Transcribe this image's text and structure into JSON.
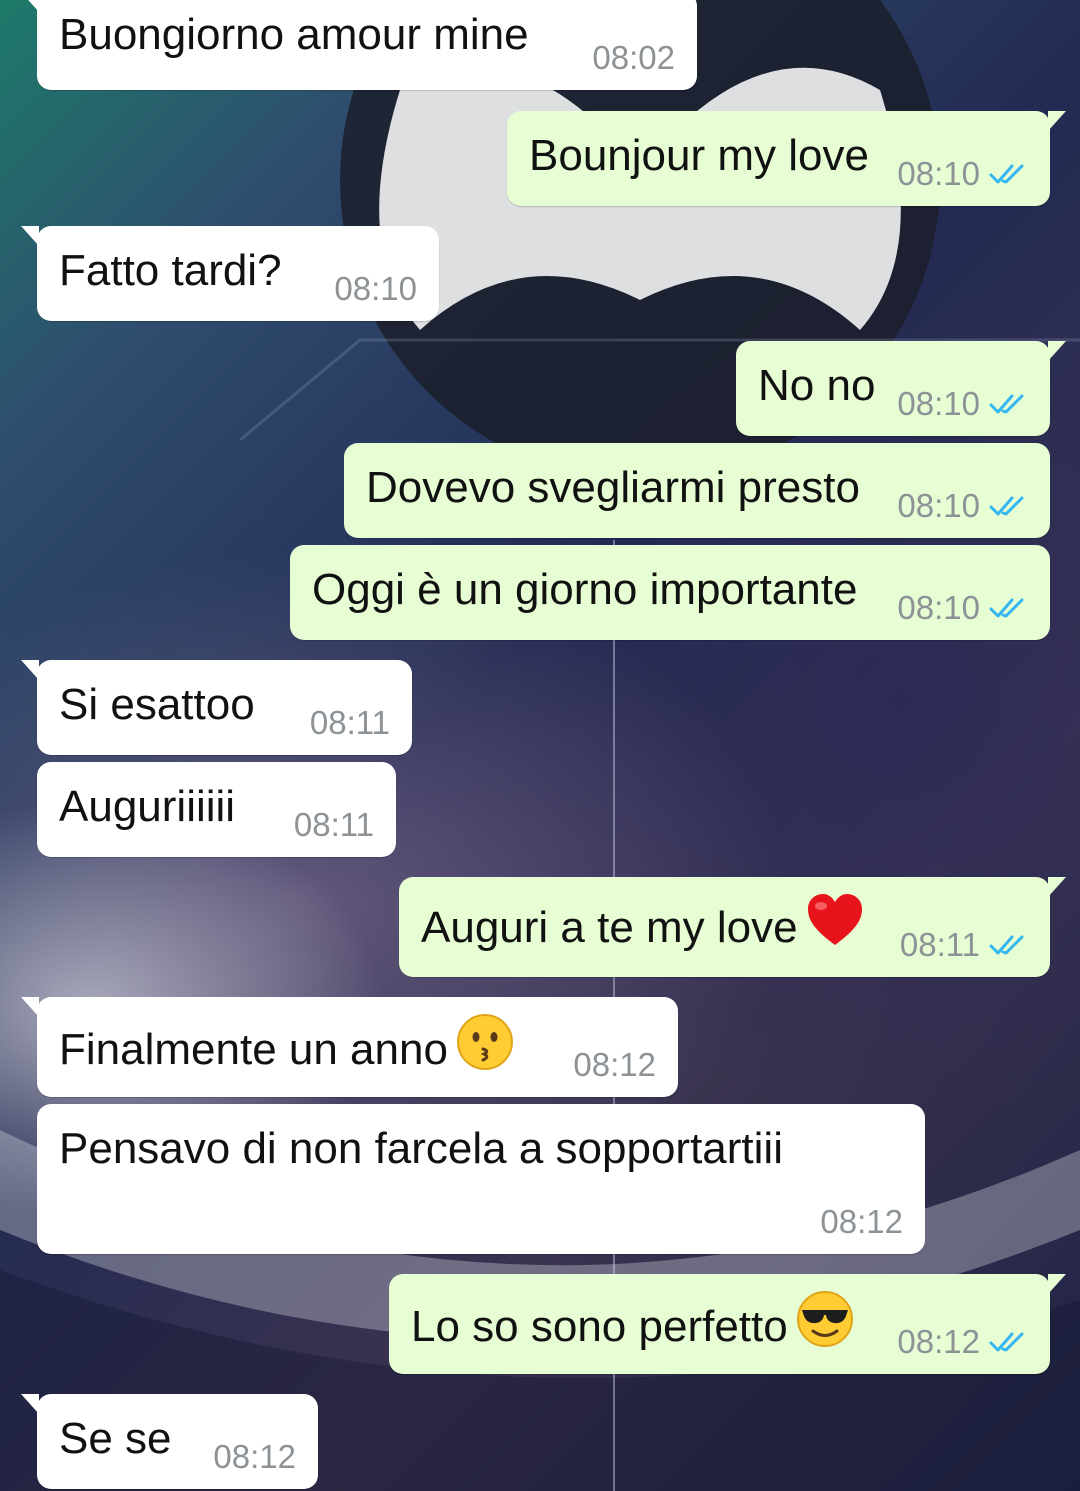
{
  "colors": {
    "incoming_bubble": "#ffffff",
    "outgoing_bubble": "#e7fdd3",
    "timestamp": "#8c9296",
    "read_ticks": "#34b7f1"
  },
  "messages": [
    {
      "direction": "in",
      "text": "Buongiorno amour mine",
      "time": "08:02"
    },
    {
      "direction": "out",
      "text": "Bounjour my love",
      "time": "08:10",
      "status": "read"
    },
    {
      "direction": "in",
      "text": "Fatto tardi?",
      "time": "08:10"
    },
    {
      "direction": "out",
      "text": "No no",
      "time": "08:10",
      "status": "read"
    },
    {
      "direction": "out",
      "text": "Dovevo svegliarmi presto",
      "time": "08:10",
      "status": "read"
    },
    {
      "direction": "out",
      "text": "Oggi è un giorno importante",
      "time": "08:10",
      "status": "read"
    },
    {
      "direction": "in",
      "text": "Si esattoo",
      "time": "08:11"
    },
    {
      "direction": "in",
      "text": "Auguriiiiii",
      "time": "08:11"
    },
    {
      "direction": "out",
      "text": "Auguri a te my love",
      "time": "08:11",
      "status": "read",
      "emoji": "red-heart"
    },
    {
      "direction": "in",
      "text": "Finalmente un anno",
      "time": "08:12",
      "emoji": "kissing-face"
    },
    {
      "direction": "in",
      "text": "Pensavo di non farcela a sopportartiii",
      "time": "08:12"
    },
    {
      "direction": "out",
      "text": "Lo so sono perfetto",
      "time": "08:12",
      "status": "read",
      "emoji": "sunglasses-face"
    },
    {
      "direction": "in",
      "text": "Se se",
      "time": "08:12"
    }
  ]
}
